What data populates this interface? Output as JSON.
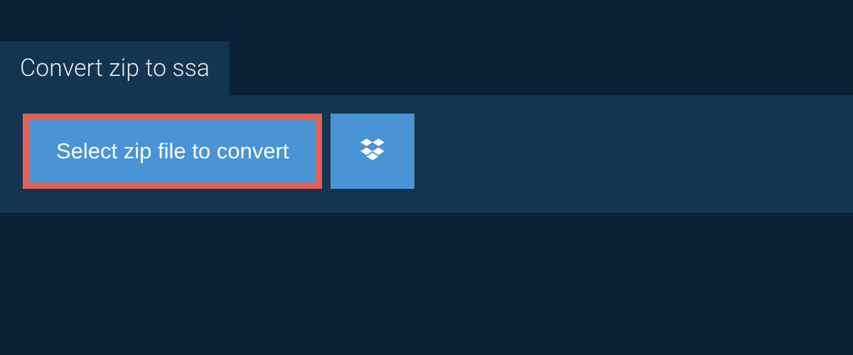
{
  "tab": {
    "label": "Convert zip to ssa"
  },
  "actions": {
    "select_file_label": "Select zip file to convert"
  },
  "colors": {
    "background_dark": "#0a2034",
    "panel": "#14344f",
    "button_blue": "#4a94d6",
    "highlight_border": "#e06258"
  }
}
